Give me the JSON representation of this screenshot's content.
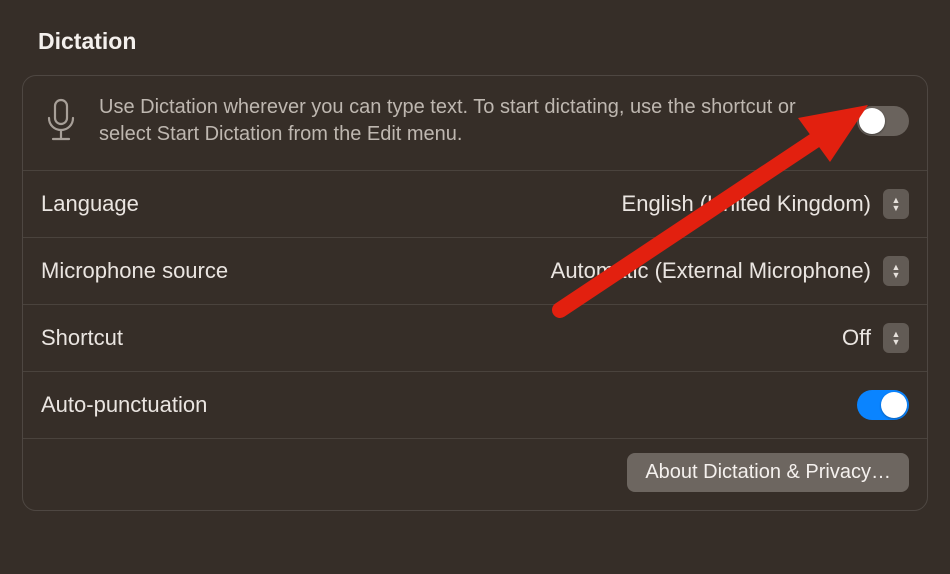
{
  "title": "Dictation",
  "intro": "Use Dictation wherever you can type text. To start dictating, use the shortcut or select Start Dictation from the Edit menu.",
  "dictation_enabled": false,
  "rows": {
    "language": {
      "label": "Language",
      "value": "English (United Kingdom)"
    },
    "microphone": {
      "label": "Microphone source",
      "value": "Automatic (External Microphone)"
    },
    "shortcut": {
      "label": "Shortcut",
      "value": "Off"
    },
    "autopunct": {
      "label": "Auto-punctuation",
      "enabled": true
    }
  },
  "about_button": "About Dictation & Privacy…",
  "colors": {
    "accent": "#0a84ff",
    "arrow": "#e2200f"
  }
}
